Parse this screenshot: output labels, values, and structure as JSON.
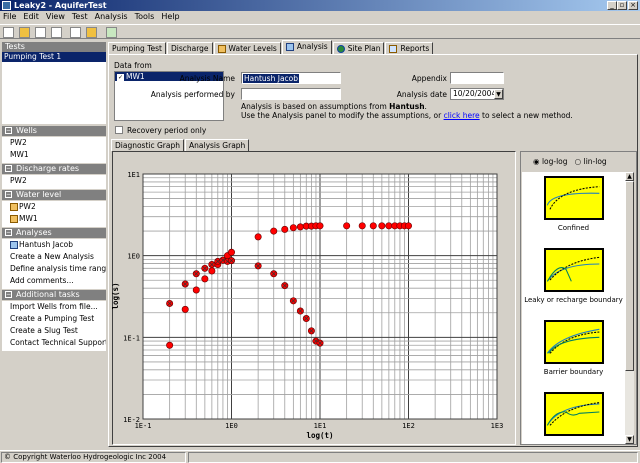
{
  "window": {
    "title": "Leaky2 - AquiferTest"
  },
  "menu": [
    "File",
    "Edit",
    "View",
    "Test",
    "Analysis",
    "Tools",
    "Help"
  ],
  "toolbar": [
    "new-icon",
    "open-icon",
    "save-icon",
    "print-icon",
    "copy-icon",
    "paste-icon",
    "refresh-icon"
  ],
  "sidebar": {
    "tests_header": "Tests",
    "tests": [
      "Pumping Test 1"
    ],
    "sections": [
      {
        "title": "Wells",
        "items": [
          "PW2",
          "MW1"
        ]
      },
      {
        "title": "Discharge rates",
        "items": [
          "PW2"
        ]
      },
      {
        "title": "Water level measurements",
        "items": [
          "PW2",
          "MW1"
        ]
      },
      {
        "title": "Analyses",
        "items": [
          "Hantush Jacob",
          "Create a New Analysis",
          "Define analysis time range...",
          "Add comments..."
        ]
      },
      {
        "title": "Additional tasks",
        "items": [
          "Import Wells from file...",
          "Create a Pumping Test",
          "Create a Slug Test",
          "Contact Technical Support..."
        ]
      }
    ]
  },
  "tabs": [
    "Pumping Test",
    "Discharge",
    "Water Levels",
    "Analysis",
    "Site Plan",
    "Reports"
  ],
  "active_tab": "Analysis",
  "analysis": {
    "data_from_label": "Data from",
    "data_from_items": [
      "MW1"
    ],
    "name_label": "Analysis Name",
    "name_value": "Hantush Jacob",
    "performed_label": "Analysis performed by",
    "performed_value": "",
    "appendix_label": "Appendix",
    "appendix_value": "",
    "date_label": "Analysis date",
    "date_value": "10/20/2004",
    "note1_pre": "Analysis is based on assumptions from ",
    "note1_bold": "Hantush",
    "note1_post": ".",
    "note2_pre": "Use the Analysis panel to modify the assumptions, or ",
    "note2_link": "click here",
    "note2_post": " to select a new method.",
    "recovery_label": "Recovery period only",
    "graph_tabs": [
      "Diagnostic Graph",
      "Analysis Graph"
    ],
    "scale_options": [
      "log-log",
      "lin-log"
    ],
    "scale_selected": "log-log",
    "diagnostic_types": [
      "Confined",
      "Leaky or recharge boundary",
      "Barrier boundary",
      ""
    ]
  },
  "status": {
    "text": "© Copyright Waterloo Hydrogeologic Inc 2004"
  },
  "chart_data": {
    "type": "scatter",
    "xlabel": "log(t)",
    "ylabel": "log(s)",
    "xscale": "log",
    "yscale": "log",
    "xlim": [
      0.1,
      1000
    ],
    "ylim": [
      0.01,
      10
    ],
    "xticks": [
      "1E-1",
      "1E0",
      "1E1",
      "1E2",
      "1E3"
    ],
    "yticks": [
      "1E-2",
      "1E-1",
      "1E0",
      "1E1"
    ],
    "grid": true,
    "marker_color": "#ff0000",
    "series": [
      {
        "x": [
          0.2,
          0.3,
          0.4,
          0.5,
          0.6,
          0.7,
          0.8,
          0.9,
          1,
          2,
          3,
          4,
          5,
          6,
          7,
          8,
          9,
          10,
          20,
          30,
          40,
          50,
          60,
          70,
          80,
          90,
          100
        ],
        "y": [
          0.08,
          0.22,
          0.38,
          0.52,
          0.65,
          0.78,
          0.88,
          1.0,
          1.1,
          1.7,
          2.0,
          2.1,
          2.2,
          2.25,
          2.3,
          2.3,
          2.32,
          2.32,
          2.32,
          2.32,
          2.32,
          2.32,
          2.32,
          2.32,
          2.32,
          2.32,
          2.32
        ]
      },
      {
        "x": [
          0.2,
          0.3,
          0.4,
          0.5,
          0.6,
          0.7,
          0.8,
          0.9,
          1,
          2,
          3,
          4,
          5,
          6,
          7,
          8,
          9,
          10
        ],
        "y": [
          0.26,
          0.45,
          0.6,
          0.7,
          0.78,
          0.85,
          0.88,
          0.85,
          0.87,
          0.75,
          0.6,
          0.43,
          0.28,
          0.21,
          0.17,
          0.12,
          0.09,
          0.085
        ]
      }
    ]
  }
}
